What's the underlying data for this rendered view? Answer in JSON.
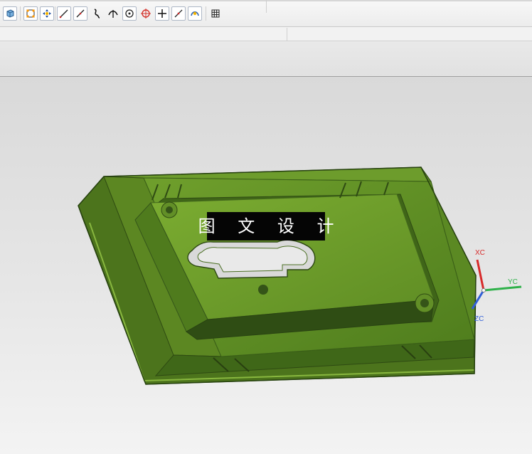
{
  "watermark": {
    "text": "图 文 设 计"
  },
  "axes": {
    "x": {
      "label": "XC",
      "color": "#d72a2a"
    },
    "y": {
      "label": "YC",
      "color": "#2fb14a"
    },
    "z": {
      "label": "ZC",
      "color": "#315fd8"
    }
  },
  "colors": {
    "model_green": "#547d1d",
    "model_highlight": "#7aa534",
    "model_shadow": "#2d4d12",
    "toolbar_bg": "#f2f2f2",
    "viewport_bg": "#e5e5e5"
  },
  "toolbar": {
    "icons": [
      "view-cube-icon",
      "snap-end-icon",
      "snap-move-icon",
      "line-icon",
      "line-icon",
      "spline-icon",
      "intersection-icon",
      "circle-center-icon",
      "target-icon",
      "plus-icon",
      "line-icon",
      "arc-icon",
      "grid-icon"
    ]
  }
}
